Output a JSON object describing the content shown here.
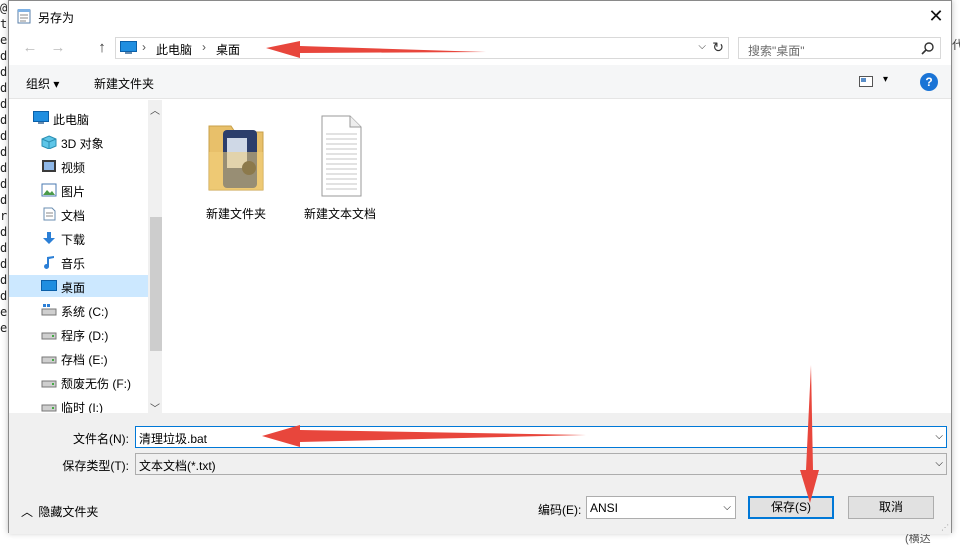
{
  "background": {
    "left_letters": [
      "@",
      "t",
      "e",
      "d",
      "d",
      "d",
      "d",
      "d",
      "d",
      "d",
      "d",
      "d",
      "d",
      "r",
      "d",
      "d",
      "d",
      "d",
      "d",
      "e",
      "e"
    ],
    "right_char": "代",
    "bottom_text": "(横达"
  },
  "dialog": {
    "title": "另存为",
    "close_label": "✕"
  },
  "address": {
    "back_label": "←",
    "forward_label": "→",
    "up_label": "↑",
    "crumbs": [
      "此电脑",
      "桌面"
    ],
    "separator": "›",
    "dropdown_glyph": "⌵",
    "refresh_glyph": "↻",
    "search_placeholder": "搜索\"桌面\""
  },
  "toolbar": {
    "organize_label": "组织 ▾",
    "new_folder_label": "新建文件夹",
    "view_drop": "▾",
    "help_label": "?"
  },
  "nav": {
    "items": [
      {
        "label": "此电脑",
        "icon": "computer-icon",
        "indent": 0
      },
      {
        "label": "3D 对象",
        "icon": "3d-objects-icon",
        "indent": 1
      },
      {
        "label": "视频",
        "icon": "video-icon",
        "indent": 1
      },
      {
        "label": "图片",
        "icon": "pictures-icon",
        "indent": 1
      },
      {
        "label": "文档",
        "icon": "documents-icon",
        "indent": 1
      },
      {
        "label": "下载",
        "icon": "download-icon",
        "indent": 1
      },
      {
        "label": "音乐",
        "icon": "music-icon",
        "indent": 1
      },
      {
        "label": "桌面",
        "icon": "desktop-icon",
        "indent": 1,
        "selected": true
      },
      {
        "label": "系统 (C:)",
        "icon": "system-drive-icon",
        "indent": 1
      },
      {
        "label": "程序 (D:)",
        "icon": "drive-icon",
        "indent": 1
      },
      {
        "label": "存档 (E:)",
        "icon": "drive-icon",
        "indent": 1
      },
      {
        "label": "颓废无伤 (F:)",
        "icon": "drive-icon",
        "indent": 1
      },
      {
        "label": "临时 (I:)",
        "icon": "drive-icon",
        "indent": 1
      }
    ],
    "scroll_up": "︿",
    "scroll_down": "﹀"
  },
  "files": [
    {
      "name": "新建文件夹",
      "icon": "folder-icon"
    },
    {
      "name": "新建文本文档",
      "icon": "text-document-icon"
    }
  ],
  "form": {
    "filename_label": "文件名(N):",
    "filename_value": "清理垃圾.bat",
    "filetype_label": "保存类型(T):",
    "filetype_value": "文本文档(*.txt)",
    "encoding_label": "编码(E):",
    "encoding_value": "ANSI",
    "hide_folders_label": "隐藏文件夹",
    "save_label": "保存(S)",
    "cancel_label": "取消",
    "dropdown_glyph": "⌵"
  },
  "annotations": {
    "arrow_color": "#e8463c"
  },
  "colors": {
    "selection": "#cce8ff",
    "accent": "#0078d7"
  }
}
